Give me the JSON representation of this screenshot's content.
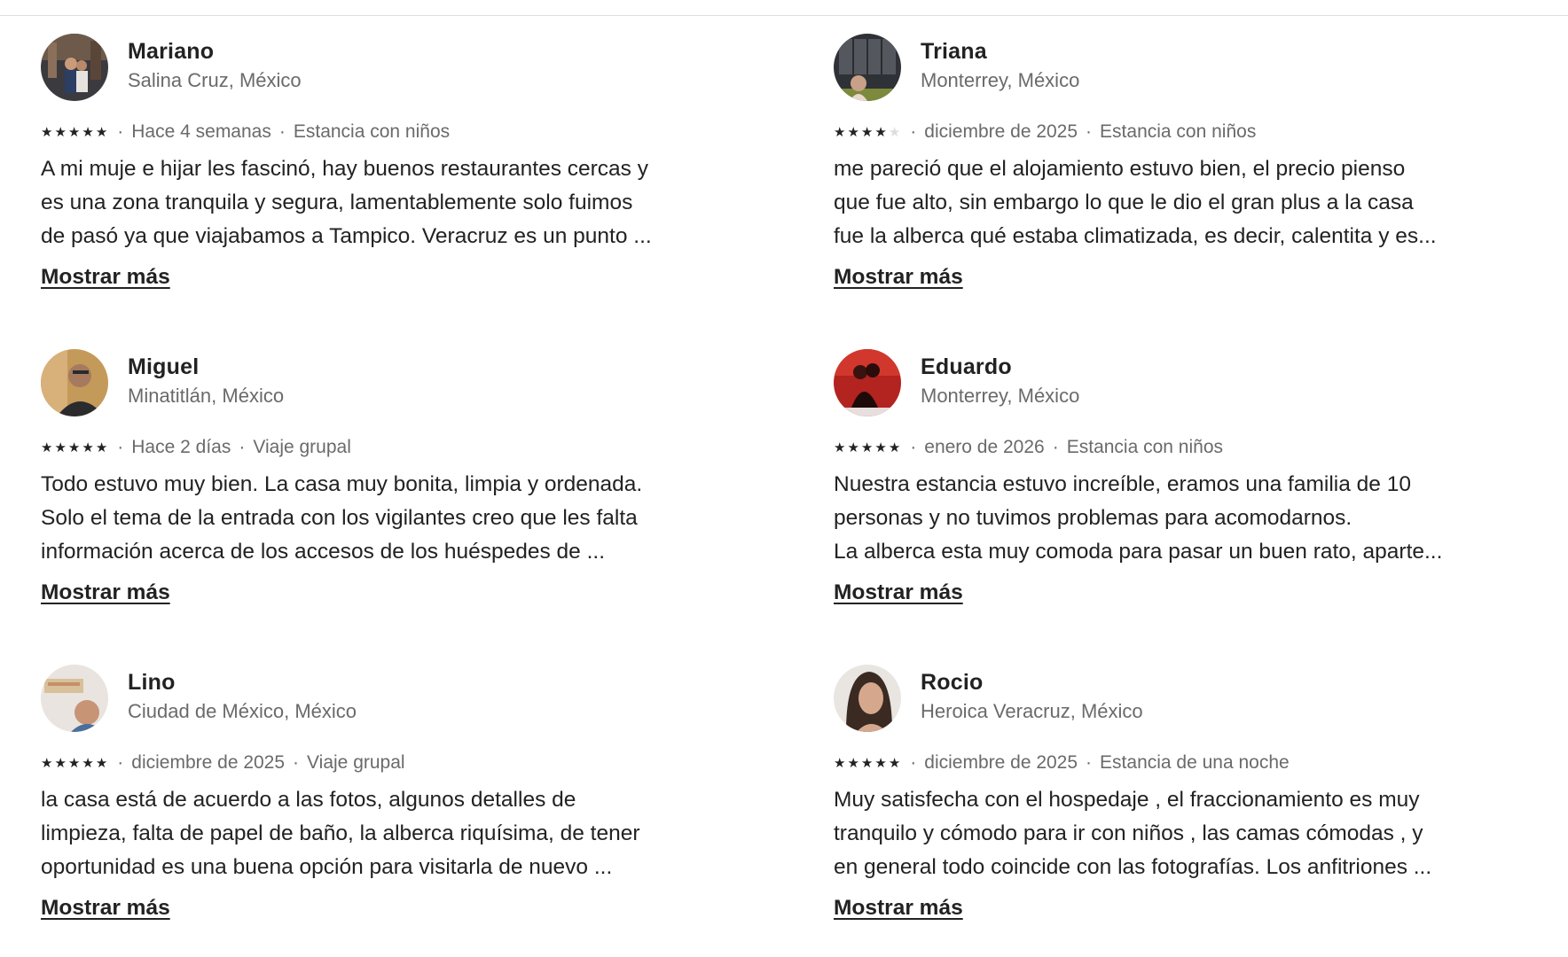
{
  "reviews": [
    {
      "name": "Mariano",
      "location": "Salina Cruz, México",
      "rating": 5,
      "date": "Hace 4 semanas",
      "trip": "Estancia con niños",
      "lines": [
        "A mi muje e hijar les fascinó, hay buenos restaurantes cercas y",
        "es una zona tranquila y segura, lamentablemente solo fuimos",
        "de pasó ya que viajabamos a Tampico. Veracruz es un punto ..."
      ],
      "more": "Mostrar más"
    },
    {
      "name": "Triana",
      "location": "Monterrey, México",
      "rating": 4,
      "date": "diciembre de 2025",
      "trip": "Estancia con niños",
      "lines": [
        "me pareció que el alojamiento estuvo bien, el precio pienso",
        "que fue alto, sin embargo lo que le dio el gran plus a la casa",
        "fue la alberca qué estaba climatizada, es decir, calentita y es..."
      ],
      "more": "Mostrar más"
    },
    {
      "name": "Miguel",
      "location": "Minatitlán, México",
      "rating": 5,
      "date": "Hace 2 días",
      "trip": "Viaje grupal",
      "lines": [
        "Todo estuvo muy bien. La casa muy bonita, limpia y ordenada.",
        "Solo el tema de la entrada  con los vigilantes creo que les falta",
        "información acerca de los accesos de los huéspedes de ..."
      ],
      "more": "Mostrar más"
    },
    {
      "name": "Eduardo",
      "location": "Monterrey, México",
      "rating": 5,
      "date": "enero de 2026",
      "trip": "Estancia con niños",
      "lines": [
        "Nuestra estancia estuvo increíble, eramos una familia de 10",
        "personas y no tuvimos problemas para acomodarnos.",
        "La alberca esta muy comoda para pasar un buen rato, aparte..."
      ],
      "more": "Mostrar más"
    },
    {
      "name": "Lino",
      "location": "Ciudad de México, México",
      "rating": 5,
      "date": "diciembre de 2025",
      "trip": "Viaje grupal",
      "lines": [
        "la casa está de acuerdo a las fotos, algunos detalles de",
        "limpieza, falta de papel de baño, la alberca riquísima, de tener",
        "oportunidad es una buena opción para visitarla de nuevo ..."
      ],
      "more": "Mostrar más"
    },
    {
      "name": "Rocio",
      "location": "Heroica Veracruz, México",
      "rating": 5,
      "date": "diciembre de 2025",
      "trip": "Estancia de una noche",
      "lines": [
        "Muy satisfecha con el hospedaje , el fraccionamiento es muy",
        "tranquilo y cómodo  para ir con niños , las camas cómodas , y",
        "en general todo coincide con las fotografías. Los anfitriones ..."
      ],
      "more": "Mostrar más"
    }
  ],
  "meta_separator": "·",
  "star_glyph": "★",
  "colors": {
    "text": "#222222",
    "secondary": "#6a6a6a",
    "divider": "#dddddd"
  }
}
